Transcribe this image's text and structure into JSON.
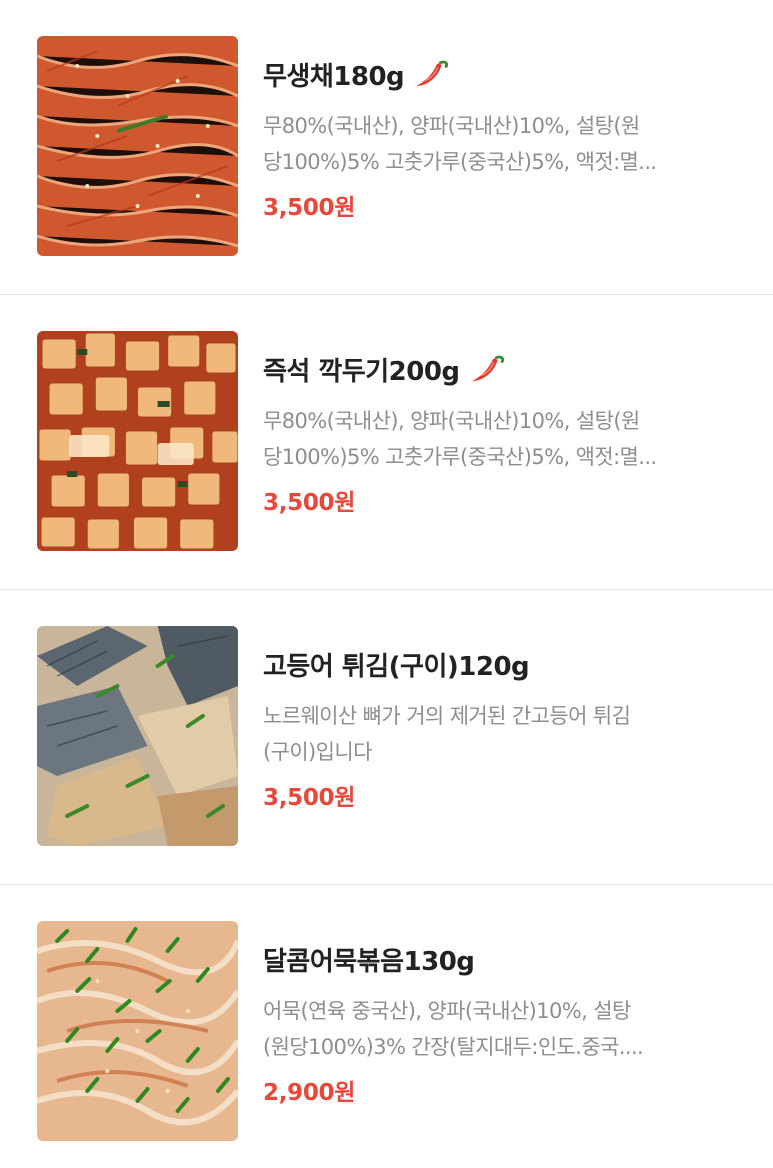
{
  "menu_items": [
    {
      "title": "무생채180g",
      "spicy": true,
      "desc_line1": "무80%(국내산), 양파(국내산)10%, 설탕(원",
      "desc_line2": "당100%)5% 고춧가루(중국산)5%, 액젓:멸...",
      "price": "3,500원"
    },
    {
      "title": "즉석 깍두기200g",
      "spicy": true,
      "desc_line1": "무80%(국내산), 양파(국내산)10%, 설탕(원",
      "desc_line2": "당100%)5% 고춧가루(중국산)5%, 액젓:멸...",
      "price": "3,500원"
    },
    {
      "title": "고등어 튀김(구이)120g",
      "spicy": false,
      "desc_line1": "노르웨이산 뼈가 거의 제거된 간고등어 튀김",
      "desc_line2": "(구이)입니다",
      "price": "3,500원"
    },
    {
      "title": "달콤어묵볶음130g",
      "spicy": false,
      "desc_line1": "어묵(연육 중국산), 양파(국내산)10%, 설탕",
      "desc_line2": "(원당100%)3% 간장(탈지대두:인도.중국....",
      "price": "2,900원"
    }
  ],
  "colors": {
    "price": "#e8473a",
    "desc": "#8e8e8e",
    "title": "#222222",
    "pepper": "#e23b2e"
  },
  "icons": {
    "spicy": "chili-pepper-icon"
  }
}
